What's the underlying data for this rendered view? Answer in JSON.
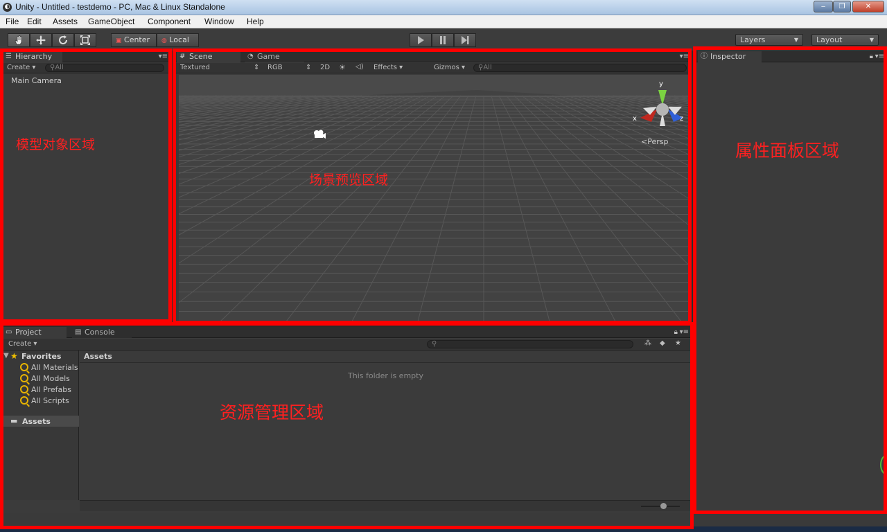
{
  "window": {
    "title": "Unity - Untitled - testdemo - PC, Mac & Linux Standalone",
    "minimize_glyph": "‒",
    "maximize_glyph": "❐",
    "close_glyph": "✕"
  },
  "menu": [
    "File",
    "Edit",
    "Assets",
    "GameObject",
    "Component",
    "Window",
    "Help"
  ],
  "toolbar": {
    "pivot": "Center",
    "space": "Local",
    "layers": "Layers",
    "layout": "Layout"
  },
  "hierarchy": {
    "tab": "Hierarchy",
    "create": "Create",
    "search_placeholder": "All",
    "items": [
      "Main Camera"
    ],
    "annotation": "模型对象区域"
  },
  "scene": {
    "tab_scene": "Scene",
    "tab_game": "Game",
    "render_mode": "Textured",
    "color_mode": "RGB",
    "mode_2d": "2D",
    "effects": "Effects",
    "gizmos": "Gizmos",
    "search_placeholder": "All",
    "gizmo_labels": {
      "y": "y",
      "x": "x",
      "z": "z"
    },
    "projection": "Persp",
    "annotation": "场景预览区域"
  },
  "inspector": {
    "tab": "Inspector",
    "annotation": "属性面板区域"
  },
  "project": {
    "tab_project": "Project",
    "tab_console": "Console",
    "create": "Create",
    "favorites_label": "Favorites",
    "favorites": [
      "All Materials",
      "All Models",
      "All Prefabs",
      "All Scripts"
    ],
    "assets_folder": "Assets",
    "breadcrumb": "Assets",
    "empty_message": "This folder is empty",
    "annotation": "资源管理区域"
  },
  "colors": {
    "highlight_outline": "#ff0000",
    "editor_bg": "#3b3b3b",
    "favorites_star": "#f0c000"
  }
}
